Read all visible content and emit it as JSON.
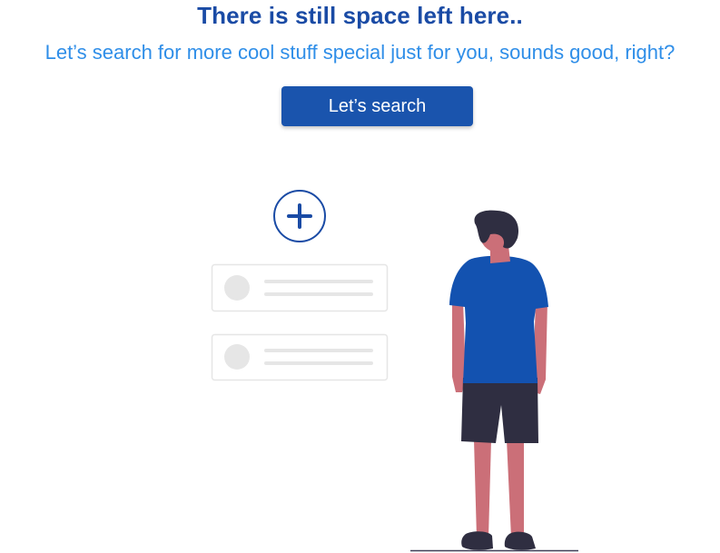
{
  "header": {
    "title": "There is still space left here..",
    "subtitle": "Let’s search for more cool stuff special just for you, sounds good, right?"
  },
  "actions": {
    "search_label": "Let’s search"
  },
  "illustration": {
    "add_icon": "plus-circle-icon",
    "placeholder_cards": 2
  },
  "colors": {
    "title": "#1a4ba5",
    "subtitle": "#2f8ee8",
    "button": "#1a54ad",
    "shirt": "#1352b0",
    "skin": "#cb6f78",
    "hair": "#2f2e41",
    "shorts": "#2f2e41",
    "card_border": "#e6e6e6",
    "card_line": "#e6e6e6"
  }
}
